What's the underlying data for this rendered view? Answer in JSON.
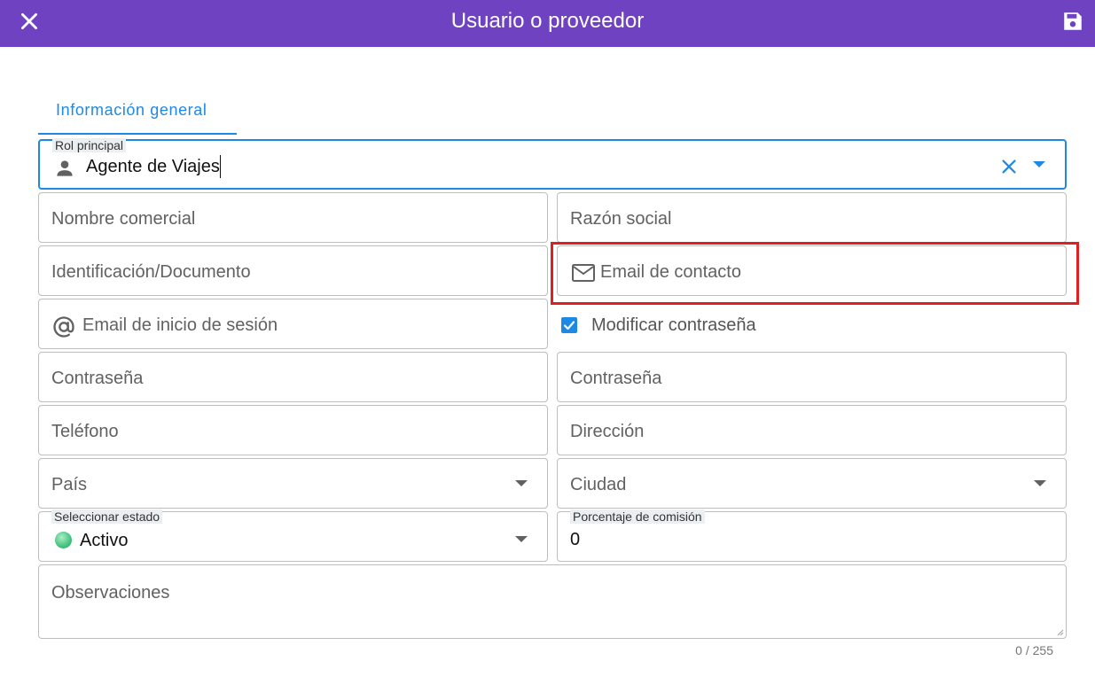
{
  "header": {
    "title": "Usuario o proveedor",
    "close_icon": "close-icon",
    "save_icon": "save-icon",
    "background": "#6f42c1"
  },
  "tabs": [
    {
      "label": "Información general",
      "active": true
    }
  ],
  "form": {
    "rol_principal": {
      "label": "Rol principal",
      "value": "Agente de Viajes",
      "icon": "person-icon"
    },
    "nombre_comercial": {
      "placeholder": "Nombre comercial"
    },
    "razon_social": {
      "placeholder": "Razón social"
    },
    "identificacion": {
      "placeholder": "Identificación/Documento"
    },
    "email_contacto": {
      "placeholder": "Email de contacto",
      "icon": "mail-icon"
    },
    "email_inicio": {
      "placeholder": "Email de inicio de sesión",
      "icon": "at-icon"
    },
    "modificar_contrasena": {
      "label": "Modificar contraseña",
      "checked": true
    },
    "contrasena_1": {
      "placeholder": "Contraseña"
    },
    "contrasena_2": {
      "placeholder": "Contraseña"
    },
    "telefono": {
      "placeholder": "Teléfono"
    },
    "direccion": {
      "placeholder": "Dirección"
    },
    "pais": {
      "placeholder": "País"
    },
    "ciudad": {
      "placeholder": "Ciudad"
    },
    "estado": {
      "label": "Seleccionar estado",
      "value": "Activo"
    },
    "comision": {
      "label": "Porcentaje de comisión",
      "value": "0"
    },
    "observaciones": {
      "placeholder": "Observaciones",
      "counter": "0 / 255"
    }
  },
  "colors": {
    "accent": "#1e88e5",
    "highlight": "#e02020",
    "status_active": "#45c27e"
  }
}
